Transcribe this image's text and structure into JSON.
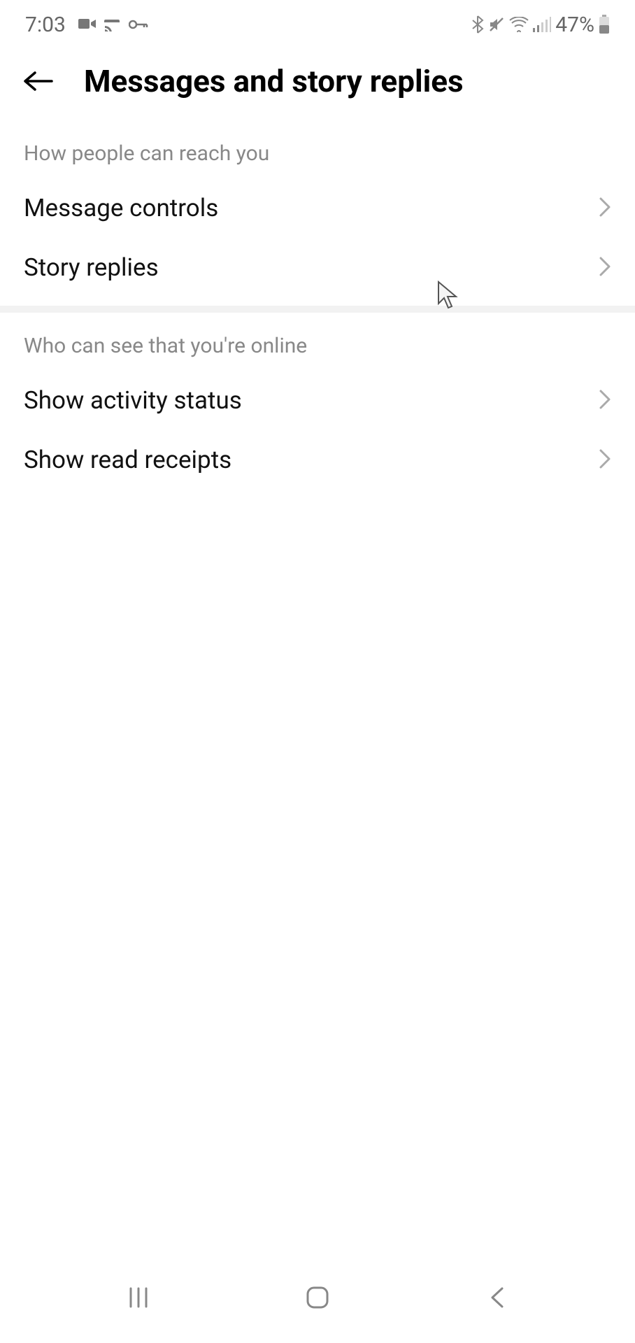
{
  "status_bar": {
    "time": "7:03",
    "battery": "47%"
  },
  "header": {
    "title": "Messages and story replies"
  },
  "sections": [
    {
      "header": "How people can reach you",
      "items": [
        {
          "label": "Message controls"
        },
        {
          "label": "Story replies"
        }
      ]
    },
    {
      "header": "Who can see that you're online",
      "items": [
        {
          "label": "Show activity status"
        },
        {
          "label": "Show read receipts"
        }
      ]
    }
  ]
}
